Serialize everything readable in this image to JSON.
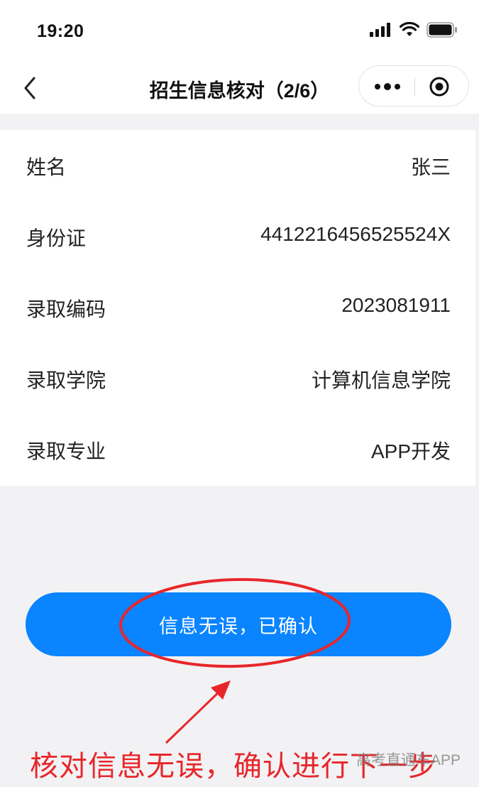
{
  "status_bar": {
    "time": "19:20",
    "icons": [
      "signal-icon",
      "wifi-icon",
      "battery-icon"
    ]
  },
  "nav": {
    "title": "招生信息核对（2/6）",
    "back_icon": "chevron-left-icon",
    "more_icon": "more-dots-icon",
    "close_icon": "target-close-icon"
  },
  "info": {
    "rows": [
      {
        "label": "姓名",
        "value": "张三"
      },
      {
        "label": "身份证",
        "value": "441221645652552​4X"
      },
      {
        "label": "录取编码",
        "value": "2023081911"
      },
      {
        "label": "录取学院",
        "value": "计算机信息学院"
      },
      {
        "label": "录取专业",
        "value": "APP开发"
      }
    ]
  },
  "confirm_button": {
    "label": "信息无误，已确认"
  },
  "annotation": {
    "text": "核对信息无误，确认进行下一步",
    "color": "#e8262a"
  },
  "watermark": "高考直通车APP",
  "colors": {
    "accent": "#0a84ff",
    "background": "#f2f2f4"
  }
}
